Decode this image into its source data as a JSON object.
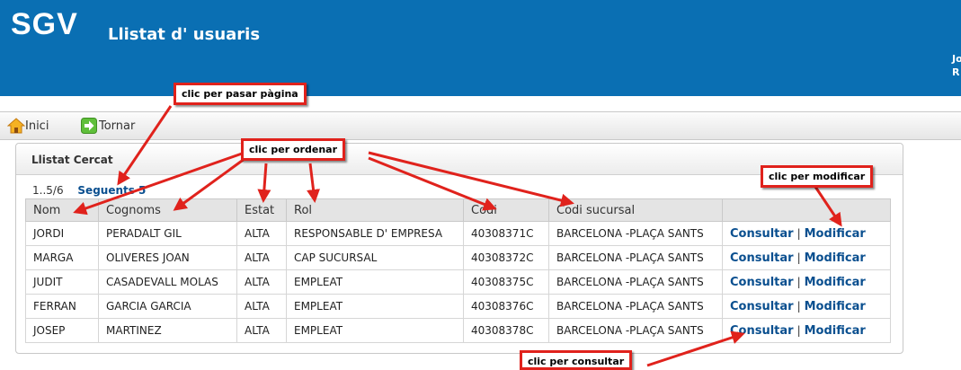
{
  "header": {
    "brand": "SGV",
    "title": "Llistat d' usuaris",
    "user_line1": "Jo",
    "user_line2": "R"
  },
  "toolbar": {
    "home_label": "Inici",
    "back_label": "Tornar"
  },
  "panel": {
    "title": "Llistat Cercat"
  },
  "pager": {
    "range": "1..5/6",
    "next_label": "Seguents 5"
  },
  "table": {
    "columns": [
      "Nom",
      "Cognoms",
      "Estat",
      "Rol",
      "Codi",
      "Codi sucursal",
      ""
    ],
    "rows": [
      {
        "nom": "JORDI",
        "cognoms": "PERADALT GIL",
        "estat": "ALTA",
        "rol": "RESPONSABLE D' EMPRESA",
        "codi": "40308371C",
        "sucursal": "BARCELONA -PLAÇA SANTS"
      },
      {
        "nom": "MARGA",
        "cognoms": "OLIVERES JOAN",
        "estat": "ALTA",
        "rol": "CAP SUCURSAL",
        "codi": "40308372C",
        "sucursal": "BARCELONA -PLAÇA SANTS"
      },
      {
        "nom": "JUDIT",
        "cognoms": "CASADEVALL MOLAS",
        "estat": "ALTA",
        "rol": "EMPLEAT",
        "codi": "40308375C",
        "sucursal": "BARCELONA -PLAÇA SANTS"
      },
      {
        "nom": "FERRAN",
        "cognoms": "GARCIA GARCIA",
        "estat": "ALTA",
        "rol": "EMPLEAT",
        "codi": "40308376C",
        "sucursal": "BARCELONA -PLAÇA SANTS"
      },
      {
        "nom": "JOSEP",
        "cognoms": "MARTINEZ",
        "estat": "ALTA",
        "rol": "EMPLEAT",
        "codi": "40308378C",
        "sucursal": "BARCELONA -PLAÇA SANTS"
      }
    ],
    "consult_label": "Consultar",
    "modify_label": "Modificar",
    "separator": "|"
  },
  "annotations": {
    "page": "clic per pasar pàgina",
    "sort": "clic per ordenar",
    "modify": "clic per modificar",
    "consult": "clic per consultar"
  },
  "colors": {
    "header_bg": "#0a6fb3",
    "link": "#0a4f8f",
    "callout_border": "#e0221c",
    "arrow": "#e0221c"
  }
}
